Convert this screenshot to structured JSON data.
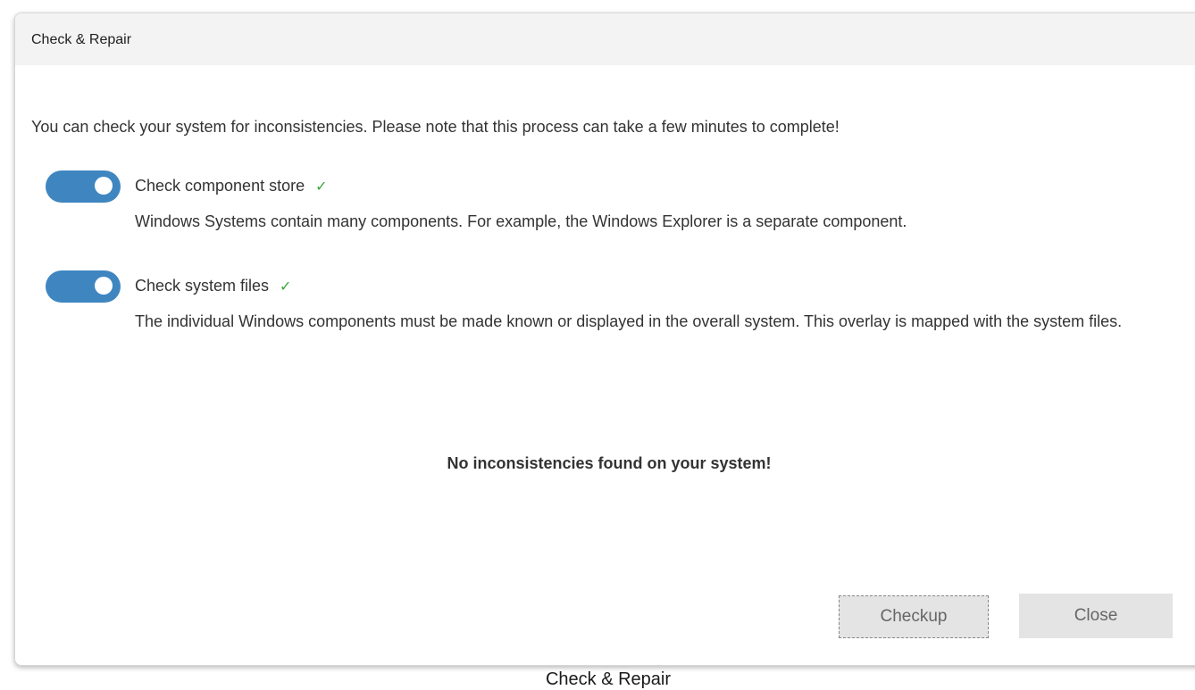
{
  "dialog": {
    "title": "Check & Repair",
    "intro": "You can check your system for inconsistencies. Please note that this process can take a few minutes to complete!",
    "options": [
      {
        "label": "Check component store",
        "enabled": true,
        "status": "✓",
        "description": "Windows Systems contain many components. For example, the Windows Explorer is a separate component."
      },
      {
        "label": "Check system files",
        "enabled": true,
        "status": "✓",
        "description": "The individual Windows components must be made known or displayed in the overall system. This overlay is mapped with the system files."
      }
    ],
    "result": "No inconsistencies found on your system!",
    "buttons": {
      "checkup": "Checkup",
      "close": "Close"
    }
  },
  "taskbar_label": "Check & Repair",
  "colors": {
    "toggle_on": "#3f86c1",
    "check_mark": "#3aa43a",
    "titlebar_bg": "#f3f3f3",
    "button_bg": "#e4e4e4"
  }
}
